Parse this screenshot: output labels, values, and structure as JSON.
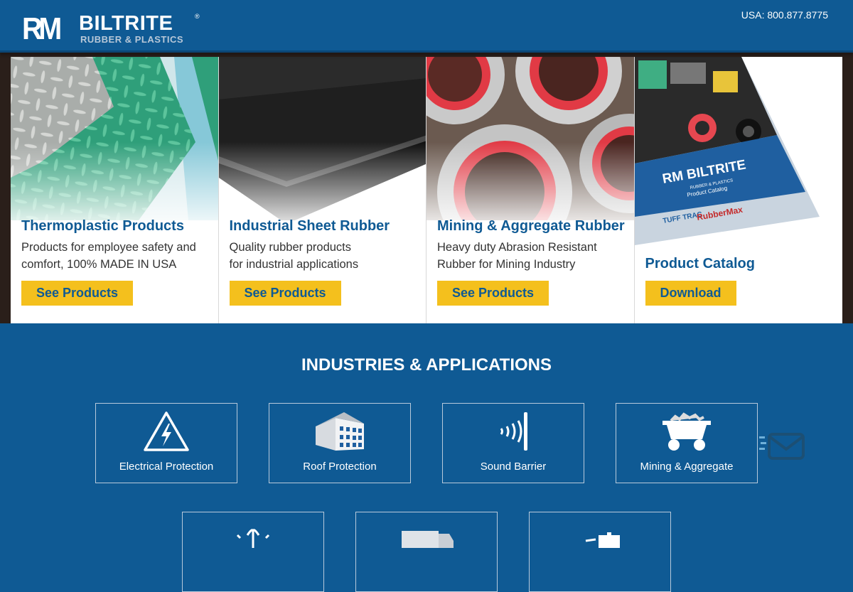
{
  "header": {
    "logo_rm": "RM",
    "logo_brand": "BILTRITE",
    "logo_sub": "RUBBER & PLASTICS",
    "logo_reg": "®",
    "phone": "USA: 800.877.8775"
  },
  "cards": [
    {
      "title": "Thermoplastic Products",
      "line1": "Products for employee safety and",
      "line2": "comfort, 100% MADE IN USA",
      "button": "See Products"
    },
    {
      "title": "Industrial Sheet Rubber",
      "line1": "Quality rubber products",
      "line2": "for industrial applications",
      "button": "See Products"
    },
    {
      "title": "Mining & Aggregate Rubber",
      "line1": "Heavy duty Abrasion Resistant",
      "line2": "Rubber for Mining Industry",
      "button": "See Products"
    },
    {
      "title": "Product Catalog",
      "button": "Download",
      "catalog_brand": "RM BILTRITE",
      "catalog_sub": "RUBBER & PLASTICS",
      "catalog_label": "Product Catalog",
      "catalog_brand1": "TUFF TRAC",
      "catalog_brand2": "RubberMax"
    }
  ],
  "industries": {
    "title": "INDUSTRIES & APPLICATIONS",
    "items": [
      {
        "label": "Electrical Protection",
        "icon": "high-voltage-icon"
      },
      {
        "label": "Roof Protection",
        "icon": "building-icon"
      },
      {
        "label": "Sound Barrier",
        "icon": "sound-wave-icon"
      },
      {
        "label": "Mining & Aggregate",
        "icon": "mine-cart-icon"
      }
    ]
  },
  "floating": {
    "icon": "mail-icon"
  },
  "colors": {
    "brand_blue": "#0f5a94",
    "accent_yellow": "#f4c01d"
  }
}
